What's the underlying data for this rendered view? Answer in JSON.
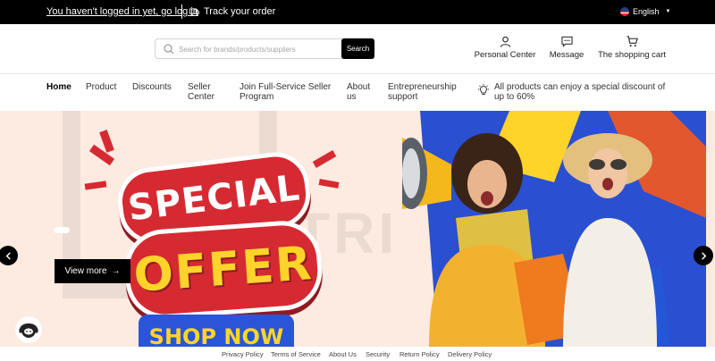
{
  "topbar": {
    "login_text": "You haven't logged in yet, go log in",
    "track_label": "Track your order",
    "language": "English"
  },
  "header": {
    "search_placeholder": "Search for brands/products/suppliers",
    "search_button": "Search",
    "personal_center": "Personal Center",
    "message": "Message",
    "cart": "The shopping cart"
  },
  "nav": {
    "items": [
      "Home",
      "Product",
      "Discounts",
      "Seller Center",
      "Join Full-Service Seller Program",
      "About us",
      "Entrepreneurship support"
    ],
    "promo": "All products can enjoy a special discount of up to 60%"
  },
  "banner": {
    "line1": "SPECIAL",
    "line2": "OFFER",
    "cta_image_text": "SHOP NOW",
    "view_more": "View more",
    "colors": {
      "background": "#fdeae0",
      "red": "#d62a32",
      "yellow": "#ffd42a",
      "blue": "#2a55d8"
    }
  },
  "footer": {
    "links": [
      "Privacy Policy",
      "Terms of Service",
      "About Us",
      "Security",
      "Return Policy",
      "Delivery Policy"
    ]
  }
}
